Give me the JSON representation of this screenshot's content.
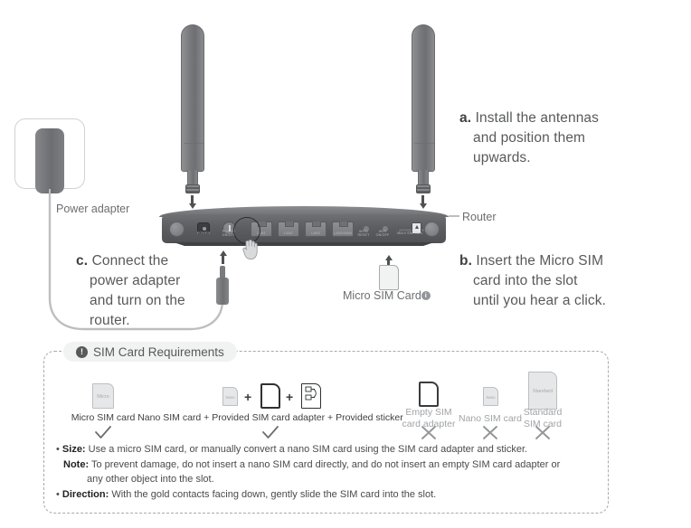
{
  "steps": {
    "a": {
      "label": "a.",
      "line1": "Install the antennas",
      "line2": "and position them",
      "line3": "upwards."
    },
    "b": {
      "label": "b.",
      "line1": "Insert the Micro SIM",
      "line2": "card into the slot",
      "line3": "until you hear a click."
    },
    "c": {
      "label": "c.",
      "line1": "Connect the",
      "line2": "power adapter",
      "line3": "and turn on the",
      "line4": "router."
    }
  },
  "device_labels": {
    "power_adapter": "Power adapter",
    "router": "Router",
    "micro_sim_card": "Micro SIM Card",
    "info_icon": "i"
  },
  "router_ports": [
    {
      "name": "power-jack-label",
      "line1": "POWER"
    },
    {
      "name": "power-switch-label",
      "line1": "POWER",
      "line2": "ON/OFF"
    },
    {
      "name": "lan1-label",
      "line1": "LAN1"
    },
    {
      "name": "lan2-label",
      "line1": "LAN2"
    },
    {
      "name": "lan3-label",
      "line1": "LAN3"
    },
    {
      "name": "lan4wan-label",
      "line1": "LAN4/WAN"
    },
    {
      "name": "wps-reset-label",
      "line1": "WPS/",
      "line2": "RESET"
    },
    {
      "name": "wifi-onoff-label",
      "line1": "WIFI",
      "line2": "ON/OFF"
    },
    {
      "name": "micro-sim-slot-label",
      "line1": "Micro SIM Card"
    }
  ],
  "panel": {
    "title": "SIM Card Requirements",
    "title_icon": "!",
    "options": [
      {
        "caption": "Micro SIM card",
        "mark": "check",
        "glyph_label": "Micro"
      },
      {
        "caption": "Nano SIM card + Provided SIM card adapter + Provided sticker",
        "mark": "check",
        "glyph_label": "Nano",
        "plus": "+"
      },
      {
        "caption_line1": "Empty SIM",
        "caption_line2": "card adapter",
        "mark": "cross"
      },
      {
        "caption_line1": "Nano SIM card",
        "mark": "cross",
        "glyph_label": "Nano"
      },
      {
        "caption_line1": "Standard",
        "caption_line2": "SIM card",
        "mark": "cross",
        "glyph_label": "Standard"
      }
    ],
    "bullets": [
      {
        "bullet": "•",
        "label": "Size:",
        "text": " Use a micro SIM card, or manually convert a nano SIM card using the SIM card adapter and sticker."
      },
      {
        "bullet": "",
        "label": "Note:",
        "text": " To prevent damage, do not insert a nano SIM card directly, and do not insert an empty SIM card adapter or"
      },
      {
        "bullet": "",
        "label": "",
        "text": "any other object into the slot."
      },
      {
        "bullet": "•",
        "label": "Direction:",
        "text": " With the gold contacts facing down, gently slide the SIM card into the slot."
      }
    ]
  },
  "colors": {
    "text": "#58595b",
    "dark_text": "#231f20",
    "muted": "#a1a3a6",
    "device_gray": "#6e7073",
    "panel_border": "#a7a9ac"
  }
}
